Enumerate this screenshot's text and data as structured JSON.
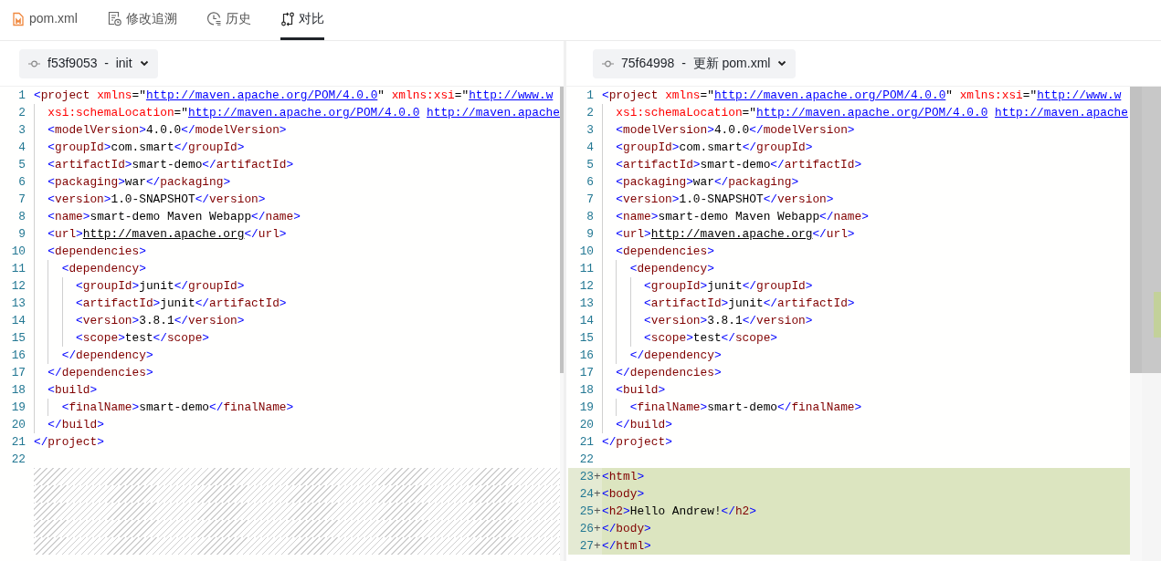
{
  "tabs": [
    {
      "label": "pom.xml",
      "selected": false
    },
    {
      "label": "修改追溯",
      "selected": false
    },
    {
      "label": "历史",
      "selected": false
    },
    {
      "label": "对比",
      "selected": true
    }
  ],
  "panes": [
    {
      "revision": "f53f9053  -  init",
      "lines": [
        {
          "number": "1",
          "kind": "context",
          "code": [
            {
              "kind": "bracket",
              "text": "<"
            },
            {
              "kind": "tag",
              "text": "project"
            },
            {
              "kind": "attr",
              "text": " xmlns"
            },
            {
              "kind": "plain",
              "text": "=\""
            },
            {
              "kind": "link",
              "text": "http://maven.apache.org/POM/4.0.0"
            },
            {
              "kind": "plain",
              "text": "\" "
            },
            {
              "kind": "attr",
              "text": "xmlns:xsi"
            },
            {
              "kind": "plain",
              "text": "=\""
            },
            {
              "kind": "link",
              "text": "http://www.w"
            }
          ],
          "children": [
            {
              "number": "2",
              "kind": "context",
              "code": [
                {
                  "kind": "attr",
                  "text": "xsi:schemaLocation"
                },
                {
                  "kind": "plain",
                  "text": "=\""
                },
                {
                  "kind": "link",
                  "text": "http://maven.apache.org/POM/4.0.0"
                },
                {
                  "kind": "link",
                  "text": "http://maven.apache"
                }
              ]
            },
            {
              "number": "3",
              "kind": "context",
              "code": [
                {
                  "kind": "bracket",
                  "text": "<"
                },
                {
                  "kind": "tag",
                  "text": "modelVersion"
                },
                {
                  "kind": "bracket",
                  "text": ">"
                },
                {
                  "kind": "plain",
                  "text": "4.0.0"
                },
                {
                  "kind": "bracket",
                  "text": "</"
                },
                {
                  "kind": "tag",
                  "text": "modelVersion"
                },
                {
                  "kind": "bracket",
                  "text": ">"
                }
              ]
            },
            {
              "number": "4",
              "kind": "context",
              "code": [
                {
                  "kind": "bracket",
                  "text": "<"
                },
                {
                  "kind": "tag",
                  "text": "groupId"
                },
                {
                  "kind": "bracket",
                  "text": ">"
                },
                {
                  "kind": "plain",
                  "text": "com.smart"
                },
                {
                  "kind": "bracket",
                  "text": "</"
                },
                {
                  "kind": "tag",
                  "text": "groupId"
                },
                {
                  "kind": "bracket",
                  "text": ">"
                }
              ]
            },
            {
              "number": "5",
              "kind": "context",
              "code": [
                {
                  "kind": "bracket",
                  "text": "<"
                },
                {
                  "kind": "tag",
                  "text": "artifactId"
                },
                {
                  "kind": "bracket",
                  "text": ">"
                },
                {
                  "kind": "plain",
                  "text": "smart-demo"
                },
                {
                  "kind": "bracket",
                  "text": "</"
                },
                {
                  "kind": "tag",
                  "text": "artifactId"
                },
                {
                  "kind": "bracket",
                  "text": ">"
                }
              ]
            },
            {
              "number": "6",
              "kind": "context",
              "code": [
                {
                  "kind": "bracket",
                  "text": "<"
                },
                {
                  "kind": "tag",
                  "text": "packaging"
                },
                {
                  "kind": "bracket",
                  "text": ">"
                },
                {
                  "kind": "plain",
                  "text": "war"
                },
                {
                  "kind": "bracket",
                  "text": "</"
                },
                {
                  "kind": "tag",
                  "text": "packaging"
                },
                {
                  "kind": "bracket",
                  "text": ">"
                }
              ]
            },
            {
              "number": "7",
              "kind": "context",
              "code": [
                {
                  "kind": "bracket",
                  "text": "<"
                },
                {
                  "kind": "tag",
                  "text": "version"
                },
                {
                  "kind": "bracket",
                  "text": ">"
                },
                {
                  "kind": "plain",
                  "text": "1.0-SNAPSHOT"
                },
                {
                  "kind": "bracket",
                  "text": "</"
                },
                {
                  "kind": "tag",
                  "text": "version"
                },
                {
                  "kind": "bracket",
                  "text": ">"
                }
              ]
            },
            {
              "number": "8",
              "kind": "context",
              "code": [
                {
                  "kind": "bracket",
                  "text": "<"
                },
                {
                  "kind": "tag",
                  "text": "name"
                },
                {
                  "kind": "bracket",
                  "text": ">"
                },
                {
                  "kind": "plain",
                  "text": "smart-demo Maven Webapp"
                },
                {
                  "kind": "bracket",
                  "text": "</"
                },
                {
                  "kind": "tag",
                  "text": "name"
                },
                {
                  "kind": "bracket",
                  "text": ">"
                }
              ]
            },
            {
              "number": "9",
              "kind": "context",
              "code": [
                {
                  "kind": "bracket",
                  "text": "<"
                },
                {
                  "kind": "tag",
                  "text": "url"
                },
                {
                  "kind": "bracket",
                  "text": ">"
                },
                {
                  "kind": "underlined",
                  "text": "http://maven.apache.org"
                },
                {
                  "kind": "bracket",
                  "text": "</"
                },
                {
                  "kind": "tag",
                  "text": "url"
                },
                {
                  "kind": "bracket",
                  "text": ">"
                }
              ]
            },
            {
              "number": "10",
              "kind": "context",
              "code": [
                {
                  "kind": "bracket",
                  "text": "<"
                },
                {
                  "kind": "tag",
                  "text": "dependencies"
                },
                {
                  "kind": "bracket",
                  "text": ">"
                }
              ],
              "children": [
                {
                  "number": "11",
                  "kind": "context",
                  "code": [
                    {
                      "kind": "bracket",
                      "text": "<"
                    },
                    {
                      "kind": "tag",
                      "text": "dependency"
                    },
                    {
                      "kind": "bracket",
                      "text": ">"
                    }
                  ],
                  "children": [
                    {
                      "number": "12",
                      "kind": "context",
                      "code": [
                        {
                          "kind": "bracket",
                          "text": "<"
                        },
                        {
                          "kind": "tag",
                          "text": "groupId"
                        },
                        {
                          "kind": "bracket",
                          "text": ">"
                        },
                        {
                          "kind": "plain",
                          "text": "junit"
                        },
                        {
                          "kind": "bracket",
                          "text": "</"
                        },
                        {
                          "kind": "tag",
                          "text": "groupId"
                        },
                        {
                          "kind": "bracket",
                          "text": ">"
                        }
                      ]
                    },
                    {
                      "number": "13",
                      "kind": "context",
                      "code": [
                        {
                          "kind": "bracket",
                          "text": "<"
                        },
                        {
                          "kind": "tag",
                          "text": "artifactId"
                        },
                        {
                          "kind": "bracket",
                          "text": ">"
                        },
                        {
                          "kind": "plain",
                          "text": "junit"
                        },
                        {
                          "kind": "bracket",
                          "text": "</"
                        },
                        {
                          "kind": "tag",
                          "text": "artifactId"
                        },
                        {
                          "kind": "bracket",
                          "text": ">"
                        }
                      ]
                    },
                    {
                      "number": "14",
                      "kind": "context",
                      "code": [
                        {
                          "kind": "bracket",
                          "text": "<"
                        },
                        {
                          "kind": "tag",
                          "text": "version"
                        },
                        {
                          "kind": "bracket",
                          "text": ">"
                        },
                        {
                          "kind": "plain",
                          "text": "3.8.1"
                        },
                        {
                          "kind": "bracket",
                          "text": "</"
                        },
                        {
                          "kind": "tag",
                          "text": "version"
                        },
                        {
                          "kind": "bracket",
                          "text": ">"
                        }
                      ]
                    },
                    {
                      "number": "15",
                      "kind": "context",
                      "code": [
                        {
                          "kind": "bracket",
                          "text": "<"
                        },
                        {
                          "kind": "tag",
                          "text": "scope"
                        },
                        {
                          "kind": "bracket",
                          "text": ">"
                        },
                        {
                          "kind": "plain",
                          "text": "test"
                        },
                        {
                          "kind": "bracket",
                          "text": "</"
                        },
                        {
                          "kind": "tag",
                          "text": "scope"
                        },
                        {
                          "kind": "bracket",
                          "text": ">"
                        }
                      ]
                    }
                  ]
                },
                {
                  "number": "16",
                  "kind": "context",
                  "code": [
                    {
                      "kind": "bracket",
                      "text": "</"
                    },
                    {
                      "kind": "tag",
                      "text": "dependency"
                    },
                    {
                      "kind": "bracket",
                      "text": ">"
                    }
                  ]
                }
              ]
            },
            {
              "number": "17",
              "kind": "context",
              "code": [
                {
                  "kind": "bracket",
                  "text": "</"
                },
                {
                  "kind": "tag",
                  "text": "dependencies"
                },
                {
                  "kind": "bracket",
                  "text": ">"
                }
              ]
            },
            {
              "number": "18",
              "kind": "context",
              "code": [
                {
                  "kind": "bracket",
                  "text": "<"
                },
                {
                  "kind": "tag",
                  "text": "build"
                },
                {
                  "kind": "bracket",
                  "text": ">"
                }
              ],
              "children": [
                {
                  "number": "19",
                  "kind": "context",
                  "code": [
                    {
                      "kind": "bracket",
                      "text": "<"
                    },
                    {
                      "kind": "tag",
                      "text": "finalName"
                    },
                    {
                      "kind": "bracket",
                      "text": ">"
                    },
                    {
                      "kind": "plain",
                      "text": "smart-demo"
                    },
                    {
                      "kind": "bracket",
                      "text": "</"
                    },
                    {
                      "kind": "tag",
                      "text": "finalName"
                    },
                    {
                      "kind": "bracket",
                      "text": ">"
                    }
                  ]
                }
              ]
            },
            {
              "number": "20",
              "kind": "context",
              "code": [
                {
                  "kind": "bracket",
                  "text": "</"
                },
                {
                  "kind": "tag",
                  "text": "build"
                },
                {
                  "kind": "bracket",
                  "text": ">"
                }
              ]
            }
          ]
        },
        {
          "number": "21",
          "kind": "context",
          "code": [
            {
              "kind": "bracket",
              "text": "</"
            },
            {
              "kind": "tag",
              "text": "project"
            },
            {
              "kind": "bracket",
              "text": ">"
            }
          ]
        },
        {
          "number": "22",
          "kind": "context"
        },
        {
          "kind": "filler"
        },
        {
          "kind": "filler"
        },
        {
          "kind": "filler"
        },
        {
          "kind": "filler"
        },
        {
          "kind": "filler"
        }
      ]
    },
    {
      "revision": "75f64998  -  更新 pom.xml",
      "lines": [
        {
          "number": "1",
          "kind": "context",
          "code": [
            {
              "kind": "bracket",
              "text": "<"
            },
            {
              "kind": "tag",
              "text": "project"
            },
            {
              "kind": "attr",
              "text": " xmlns"
            },
            {
              "kind": "plain",
              "text": "=\""
            },
            {
              "kind": "link",
              "text": "http://maven.apache.org/POM/4.0.0"
            },
            {
              "kind": "plain",
              "text": "\" "
            },
            {
              "kind": "attr",
              "text": "xmlns:xsi"
            },
            {
              "kind": "plain",
              "text": "=\""
            },
            {
              "kind": "link",
              "text": "http://www.w"
            }
          ],
          "children": [
            {
              "number": "2",
              "kind": "context",
              "code": [
                {
                  "kind": "attr",
                  "text": "xsi:schemaLocation"
                },
                {
                  "kind": "plain",
                  "text": "=\""
                },
                {
                  "kind": "link",
                  "text": "http://maven.apache.org/POM/4.0.0"
                },
                {
                  "kind": "link",
                  "text": "http://maven.apache"
                }
              ]
            },
            {
              "number": "3",
              "kind": "context",
              "code": [
                {
                  "kind": "bracket",
                  "text": "<"
                },
                {
                  "kind": "tag",
                  "text": "modelVersion"
                },
                {
                  "kind": "bracket",
                  "text": ">"
                },
                {
                  "kind": "plain",
                  "text": "4.0.0"
                },
                {
                  "kind": "bracket",
                  "text": "</"
                },
                {
                  "kind": "tag",
                  "text": "modelVersion"
                },
                {
                  "kind": "bracket",
                  "text": ">"
                }
              ]
            },
            {
              "number": "4",
              "kind": "context",
              "code": [
                {
                  "kind": "bracket",
                  "text": "<"
                },
                {
                  "kind": "tag",
                  "text": "groupId"
                },
                {
                  "kind": "bracket",
                  "text": ">"
                },
                {
                  "kind": "plain",
                  "text": "com.smart"
                },
                {
                  "kind": "bracket",
                  "text": "</"
                },
                {
                  "kind": "tag",
                  "text": "groupId"
                },
                {
                  "kind": "bracket",
                  "text": ">"
                }
              ]
            },
            {
              "number": "5",
              "kind": "context",
              "code": [
                {
                  "kind": "bracket",
                  "text": "<"
                },
                {
                  "kind": "tag",
                  "text": "artifactId"
                },
                {
                  "kind": "bracket",
                  "text": ">"
                },
                {
                  "kind": "plain",
                  "text": "smart-demo"
                },
                {
                  "kind": "bracket",
                  "text": "</"
                },
                {
                  "kind": "tag",
                  "text": "artifactId"
                },
                {
                  "kind": "bracket",
                  "text": ">"
                }
              ]
            },
            {
              "number": "6",
              "kind": "context",
              "code": [
                {
                  "kind": "bracket",
                  "text": "<"
                },
                {
                  "kind": "tag",
                  "text": "packaging"
                },
                {
                  "kind": "bracket",
                  "text": ">"
                },
                {
                  "kind": "plain",
                  "text": "war"
                },
                {
                  "kind": "bracket",
                  "text": "</"
                },
                {
                  "kind": "tag",
                  "text": "packaging"
                },
                {
                  "kind": "bracket",
                  "text": ">"
                }
              ]
            },
            {
              "number": "7",
              "kind": "context",
              "code": [
                {
                  "kind": "bracket",
                  "text": "<"
                },
                {
                  "kind": "tag",
                  "text": "version"
                },
                {
                  "kind": "bracket",
                  "text": ">"
                },
                {
                  "kind": "plain",
                  "text": "1.0-SNAPSHOT"
                },
                {
                  "kind": "bracket",
                  "text": "</"
                },
                {
                  "kind": "tag",
                  "text": "version"
                },
                {
                  "kind": "bracket",
                  "text": ">"
                }
              ]
            },
            {
              "number": "8",
              "kind": "context",
              "code": [
                {
                  "kind": "bracket",
                  "text": "<"
                },
                {
                  "kind": "tag",
                  "text": "name"
                },
                {
                  "kind": "bracket",
                  "text": ">"
                },
                {
                  "kind": "plain",
                  "text": "smart-demo Maven Webapp"
                },
                {
                  "kind": "bracket",
                  "text": "</"
                },
                {
                  "kind": "tag",
                  "text": "name"
                },
                {
                  "kind": "bracket",
                  "text": ">"
                }
              ]
            },
            {
              "number": "9",
              "kind": "context",
              "code": [
                {
                  "kind": "bracket",
                  "text": "<"
                },
                {
                  "kind": "tag",
                  "text": "url"
                },
                {
                  "kind": "bracket",
                  "text": ">"
                },
                {
                  "kind": "underlined",
                  "text": "http://maven.apache.org"
                },
                {
                  "kind": "bracket",
                  "text": "</"
                },
                {
                  "kind": "tag",
                  "text": "url"
                },
                {
                  "kind": "bracket",
                  "text": ">"
                }
              ]
            },
            {
              "number": "10",
              "kind": "context",
              "code": [
                {
                  "kind": "bracket",
                  "text": "<"
                },
                {
                  "kind": "tag",
                  "text": "dependencies"
                },
                {
                  "kind": "bracket",
                  "text": ">"
                }
              ],
              "children": [
                {
                  "number": "11",
                  "kind": "context",
                  "code": [
                    {
                      "kind": "bracket",
                      "text": "<"
                    },
                    {
                      "kind": "tag",
                      "text": "dependency"
                    },
                    {
                      "kind": "bracket",
                      "text": ">"
                    }
                  ],
                  "children": [
                    {
                      "number": "12",
                      "kind": "context",
                      "code": [
                        {
                          "kind": "bracket",
                          "text": "<"
                        },
                        {
                          "kind": "tag",
                          "text": "groupId"
                        },
                        {
                          "kind": "bracket",
                          "text": ">"
                        },
                        {
                          "kind": "plain",
                          "text": "junit"
                        },
                        {
                          "kind": "bracket",
                          "text": "</"
                        },
                        {
                          "kind": "tag",
                          "text": "groupId"
                        },
                        {
                          "kind": "bracket",
                          "text": ">"
                        }
                      ]
                    },
                    {
                      "number": "13",
                      "kind": "context",
                      "code": [
                        {
                          "kind": "bracket",
                          "text": "<"
                        },
                        {
                          "kind": "tag",
                          "text": "artifactId"
                        },
                        {
                          "kind": "bracket",
                          "text": ">"
                        },
                        {
                          "kind": "plain",
                          "text": "junit"
                        },
                        {
                          "kind": "bracket",
                          "text": "</"
                        },
                        {
                          "kind": "tag",
                          "text": "artifactId"
                        },
                        {
                          "kind": "bracket",
                          "text": ">"
                        }
                      ]
                    },
                    {
                      "number": "14",
                      "kind": "context",
                      "code": [
                        {
                          "kind": "bracket",
                          "text": "<"
                        },
                        {
                          "kind": "tag",
                          "text": "version"
                        },
                        {
                          "kind": "bracket",
                          "text": ">"
                        },
                        {
                          "kind": "plain",
                          "text": "3.8.1"
                        },
                        {
                          "kind": "bracket",
                          "text": "</"
                        },
                        {
                          "kind": "tag",
                          "text": "version"
                        },
                        {
                          "kind": "bracket",
                          "text": ">"
                        }
                      ]
                    },
                    {
                      "number": "15",
                      "kind": "context",
                      "code": [
                        {
                          "kind": "bracket",
                          "text": "<"
                        },
                        {
                          "kind": "tag",
                          "text": "scope"
                        },
                        {
                          "kind": "bracket",
                          "text": ">"
                        },
                        {
                          "kind": "plain",
                          "text": "test"
                        },
                        {
                          "kind": "bracket",
                          "text": "</"
                        },
                        {
                          "kind": "tag",
                          "text": "scope"
                        },
                        {
                          "kind": "bracket",
                          "text": ">"
                        }
                      ]
                    }
                  ]
                },
                {
                  "number": "16",
                  "kind": "context",
                  "code": [
                    {
                      "kind": "bracket",
                      "text": "</"
                    },
                    {
                      "kind": "tag",
                      "text": "dependency"
                    },
                    {
                      "kind": "bracket",
                      "text": ">"
                    }
                  ]
                }
              ]
            },
            {
              "number": "17",
              "kind": "context",
              "code": [
                {
                  "kind": "bracket",
                  "text": "</"
                },
                {
                  "kind": "tag",
                  "text": "dependencies"
                },
                {
                  "kind": "bracket",
                  "text": ">"
                }
              ]
            },
            {
              "number": "18",
              "kind": "context",
              "code": [
                {
                  "kind": "bracket",
                  "text": "<"
                },
                {
                  "kind": "tag",
                  "text": "build"
                },
                {
                  "kind": "bracket",
                  "text": ">"
                }
              ],
              "children": [
                {
                  "number": "19",
                  "kind": "context",
                  "code": [
                    {
                      "kind": "bracket",
                      "text": "<"
                    },
                    {
                      "kind": "tag",
                      "text": "finalName"
                    },
                    {
                      "kind": "bracket",
                      "text": ">"
                    },
                    {
                      "kind": "plain",
                      "text": "smart-demo"
                    },
                    {
                      "kind": "bracket",
                      "text": "</"
                    },
                    {
                      "kind": "tag",
                      "text": "finalName"
                    },
                    {
                      "kind": "bracket",
                      "text": ">"
                    }
                  ]
                }
              ]
            },
            {
              "number": "20",
              "kind": "context",
              "code": [
                {
                  "kind": "bracket",
                  "text": "</"
                },
                {
                  "kind": "tag",
                  "text": "build"
                },
                {
                  "kind": "bracket",
                  "text": ">"
                }
              ]
            }
          ]
        },
        {
          "number": "21",
          "kind": "context",
          "code": [
            {
              "kind": "bracket",
              "text": "</"
            },
            {
              "kind": "tag",
              "text": "project"
            },
            {
              "kind": "bracket",
              "text": ">"
            }
          ]
        },
        {
          "number": "22",
          "kind": "context"
        },
        {
          "number": "23",
          "kind": "added",
          "marker": "+",
          "code": [
            {
              "kind": "bracket",
              "text": "<"
            },
            {
              "kind": "tag",
              "text": "html"
            },
            {
              "kind": "bracket",
              "text": ">"
            }
          ]
        },
        {
          "number": "24",
          "kind": "added",
          "marker": "+",
          "code": [
            {
              "kind": "bracket",
              "text": "<"
            },
            {
              "kind": "tag",
              "text": "body"
            },
            {
              "kind": "bracket",
              "text": ">"
            }
          ]
        },
        {
          "number": "25",
          "kind": "added",
          "marker": "+",
          "code": [
            {
              "kind": "bracket",
              "text": "<"
            },
            {
              "kind": "tag",
              "text": "h2"
            },
            {
              "kind": "bracket",
              "text": ">"
            },
            {
              "kind": "plain",
              "text": "Hello Andrew!"
            },
            {
              "kind": "bracket",
              "text": "</"
            },
            {
              "kind": "tag",
              "text": "h2"
            },
            {
              "kind": "bracket",
              "text": ">"
            }
          ]
        },
        {
          "number": "26",
          "kind": "added",
          "marker": "+",
          "code": [
            {
              "kind": "bracket",
              "text": "</"
            },
            {
              "kind": "tag",
              "text": "body"
            },
            {
              "kind": "bracket",
              "text": ">"
            }
          ]
        },
        {
          "number": "27",
          "kind": "added",
          "marker": "+",
          "code": [
            {
              "kind": "bracket",
              "text": "</"
            },
            {
              "kind": "tag",
              "text": "html"
            },
            {
              "kind": "bracket",
              "text": ">"
            }
          ]
        }
      ]
    }
  ]
}
